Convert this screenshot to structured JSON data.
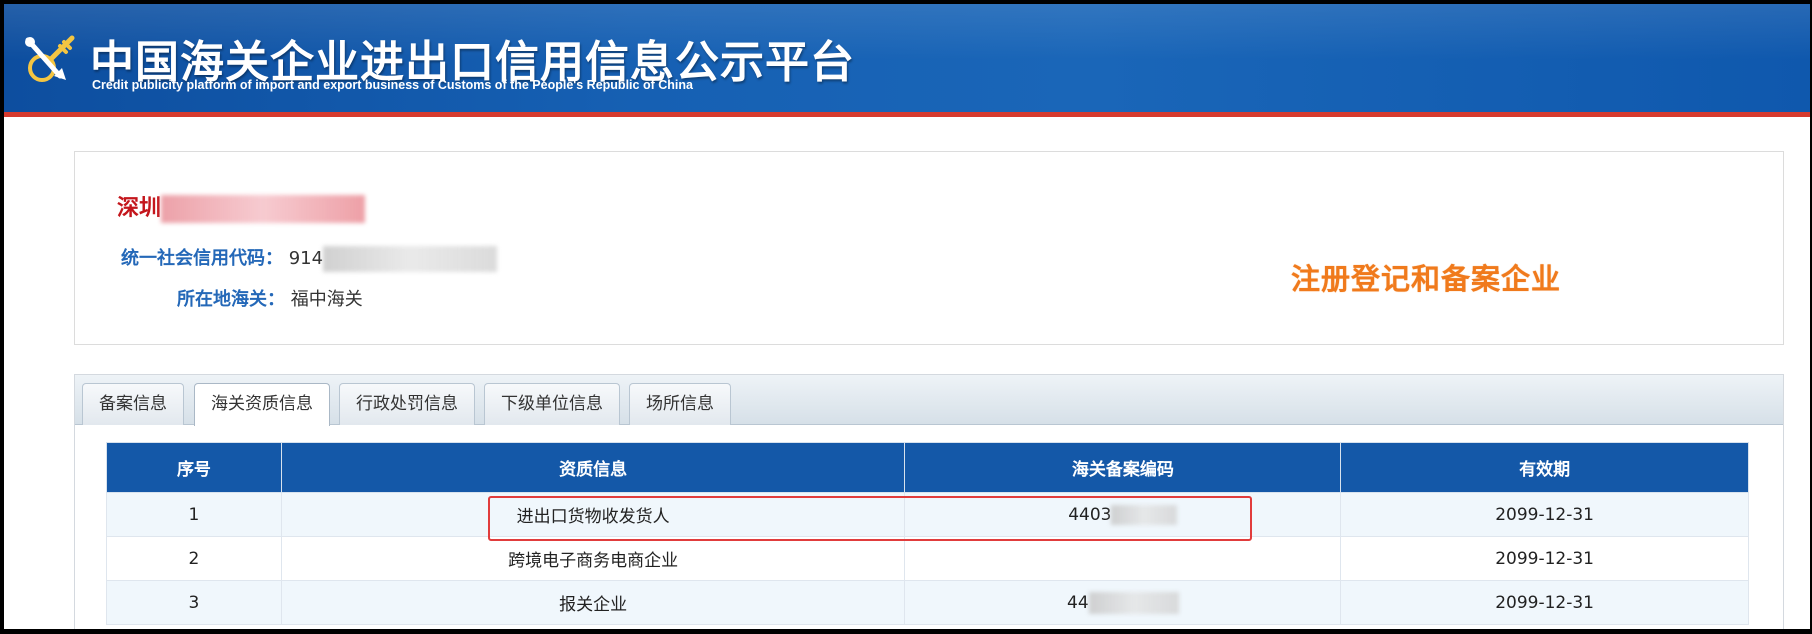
{
  "header": {
    "title": "中国海关企业进出口信用信息公示平台",
    "subtitle": "Credit publicity platform of import and export business of Customs of the People's Republic of China",
    "brand_color": "#1660b3",
    "accent_line_color": "#d63a2e"
  },
  "company": {
    "name_visible": "深圳",
    "credit_code_label": "统一社会信用代码：",
    "credit_code_visible": "914",
    "customs_label": "所在地海关：",
    "customs_value": "福中海关",
    "status": "注册登记和备案企业",
    "name_color": "#c4161c",
    "status_color": "#f07a1c"
  },
  "tabs": [
    {
      "label": "备案信息",
      "active": false
    },
    {
      "label": "海关资质信息",
      "active": true
    },
    {
      "label": "行政处罚信息",
      "active": false
    },
    {
      "label": "下级单位信息",
      "active": false
    },
    {
      "label": "场所信息",
      "active": false
    }
  ],
  "table": {
    "headers": [
      "序号",
      "资质信息",
      "海关备案编码",
      "有效期"
    ],
    "rows": [
      {
        "no": "1",
        "qualification": "进出口货物收发货人",
        "code_visible": "4403",
        "validity": "2099-12-31"
      },
      {
        "no": "2",
        "qualification": "跨境电子商务电商企业",
        "code_visible": "",
        "validity": "2099-12-31"
      },
      {
        "no": "3",
        "qualification": "报关企业",
        "code_visible": "44",
        "validity": "2099-12-31"
      }
    ]
  }
}
